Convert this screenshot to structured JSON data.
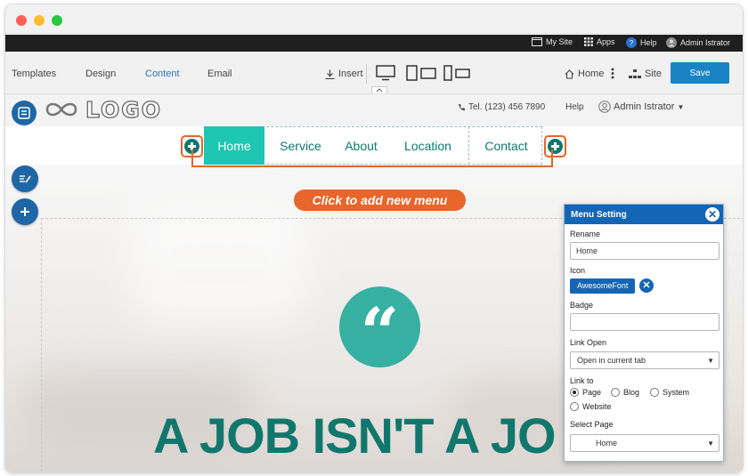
{
  "adminbar": {
    "my_site": "My Site",
    "apps": "Apps",
    "help": "Help",
    "user": "Admin Istrator"
  },
  "toolbar": {
    "tabs": [
      "Templates",
      "Design",
      "Content",
      "Email"
    ],
    "active_tab": "Content",
    "insert": "Insert",
    "home": "Home",
    "site": "Site",
    "save": "Save"
  },
  "site_header": {
    "logo": "LOGO",
    "tel": "Tel. (123) 456 7890",
    "help": "Help",
    "user": "Admin Istrator"
  },
  "menu": {
    "items": [
      "Home",
      "Service",
      "About",
      "Location",
      "Contact"
    ],
    "active": "Home"
  },
  "callout": "Click to add new menu",
  "hero": {
    "quote_mark": "“",
    "headline": "A JOB ISN'T A JO"
  },
  "panel": {
    "title": "Menu Setting",
    "rename_label": "Rename",
    "rename_value": "Home",
    "icon_label": "Icon",
    "icon_chip": "AwesomeFont",
    "badge_label": "Badge",
    "badge_value": "",
    "link_open_label": "Link Open",
    "link_open_value": "Open in current tab",
    "link_to_label": "Link to",
    "link_options": [
      "Page",
      "Blog",
      "System",
      "Website"
    ],
    "link_selected": "Page",
    "select_page_label": "Select Page",
    "select_page_value": "Home"
  },
  "colors": {
    "accent_teal": "#1ec7b2",
    "dark_teal": "#11776d",
    "callout_orange": "#e8652b",
    "primary_blue": "#1565b6",
    "save_blue": "#1a83c4"
  }
}
